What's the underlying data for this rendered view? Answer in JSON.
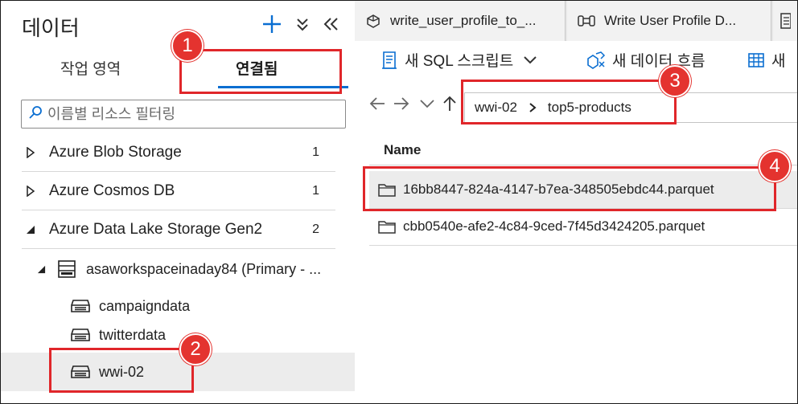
{
  "left_pane": {
    "title": "데이터",
    "tabs": [
      {
        "label": "작업 영역",
        "active": false
      },
      {
        "label": "연결됨",
        "active": true
      }
    ],
    "filter_placeholder": "이름별 리소스 필터링",
    "tree": [
      {
        "label": "Azure Blob Storage",
        "count": "1",
        "expanded": false
      },
      {
        "label": "Azure Cosmos DB",
        "count": "1",
        "expanded": false
      },
      {
        "label": "Azure Data Lake Storage Gen2",
        "count": "2",
        "expanded": true
      }
    ],
    "account": {
      "label": "asaworkspaceinaday84 (Primary - ...",
      "expanded": true
    },
    "containers": [
      {
        "label": "campaigndata",
        "selected": false
      },
      {
        "label": "twitterdata",
        "selected": false
      },
      {
        "label": "wwi-02",
        "selected": true
      }
    ]
  },
  "right_pane": {
    "doc_tabs": [
      {
        "label": "write_user_profile_to_...",
        "icon": "pipeline-icon"
      },
      {
        "label": "Write User Profile D...",
        "icon": "dataflow-icon"
      }
    ],
    "toolbar": [
      {
        "label": "새 SQL 스크립트",
        "icon": "sql-script-icon",
        "has_dropdown": true
      },
      {
        "label": "새 데이터 흐름",
        "icon": "dataflow-icon"
      },
      {
        "label": "새 ",
        "icon": "table-icon"
      }
    ],
    "path": [
      "wwi-02",
      "top5-products"
    ],
    "column_header": "Name",
    "files": [
      {
        "name": "16bb8447-824a-4147-b7ea-348505ebdc44.parquet",
        "selected": true
      },
      {
        "name": "cbb0540e-afe2-4c84-9ced-7f45d3424205.parquet",
        "selected": false
      }
    ]
  },
  "callouts": [
    "1",
    "2",
    "3",
    "4"
  ],
  "colors": {
    "accent": "#0a6ed1",
    "callout": "#e0262a",
    "selected_bg": "#ececec"
  }
}
